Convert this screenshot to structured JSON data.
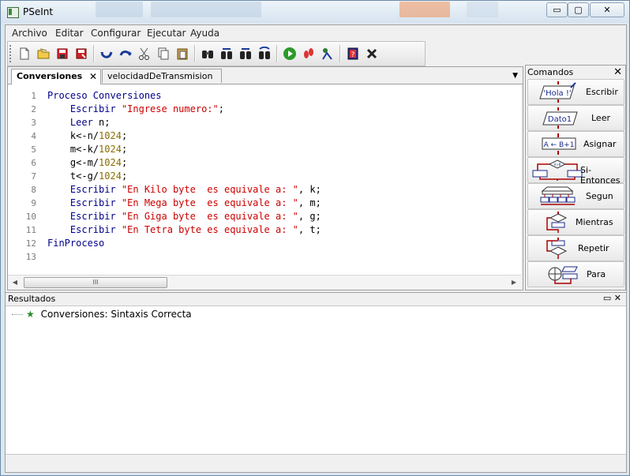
{
  "window": {
    "title": "PSeInt",
    "controls": {
      "minimize": "▭",
      "restore": "▢",
      "close": "✕"
    }
  },
  "menubar": {
    "items": [
      "Archivo",
      "Editar",
      "Configurar",
      "Ejecutar",
      "Ayuda"
    ]
  },
  "toolbar": {
    "buttons": [
      "new-file",
      "open-file",
      "save-file",
      "save-as",
      "undo",
      "redo",
      "cut",
      "copy",
      "paste",
      "find",
      "find-next",
      "find-prev",
      "replace",
      "run",
      "run-step",
      "explain",
      "help",
      "close"
    ]
  },
  "editor": {
    "tabs": [
      {
        "label": "Conversiones",
        "active": true,
        "close": "✕"
      },
      {
        "label": "velocidadDeTransmision",
        "active": false
      }
    ],
    "line_numbers": [
      "1",
      "2",
      "3",
      "4",
      "5",
      "6",
      "7",
      "8",
      "9",
      "10",
      "11",
      "12",
      "13"
    ],
    "lines": [
      [
        {
          "t": "Proceso ",
          "c": "kw"
        },
        {
          "t": "Conversiones",
          "c": "kw"
        }
      ],
      [
        {
          "t": "    Escribir ",
          "c": "kw"
        },
        {
          "t": "\"Ingrese numero:\"",
          "c": "st"
        },
        {
          "t": ";",
          "c": ""
        }
      ],
      [
        {
          "t": "    Leer ",
          "c": "kw"
        },
        {
          "t": "n;",
          "c": ""
        }
      ],
      [
        {
          "t": "    k<-n/",
          "c": ""
        },
        {
          "t": "1024",
          "c": "nm"
        },
        {
          "t": ";",
          "c": ""
        }
      ],
      [
        {
          "t": "    m<-k/",
          "c": ""
        },
        {
          "t": "1024",
          "c": "nm"
        },
        {
          "t": ";",
          "c": ""
        }
      ],
      [
        {
          "t": "    g<-m/",
          "c": ""
        },
        {
          "t": "1024",
          "c": "nm"
        },
        {
          "t": ";",
          "c": ""
        }
      ],
      [
        {
          "t": "    t<-g/",
          "c": ""
        },
        {
          "t": "1024",
          "c": "nm"
        },
        {
          "t": ";",
          "c": ""
        }
      ],
      [
        {
          "t": "    Escribir ",
          "c": "kw"
        },
        {
          "t": "\"En Kilo byte  es equivale a: \"",
          "c": "st"
        },
        {
          "t": ", k;",
          "c": ""
        }
      ],
      [
        {
          "t": "    Escribir ",
          "c": "kw"
        },
        {
          "t": "\"En Mega byte  es equivale a: \"",
          "c": "st"
        },
        {
          "t": ", m;",
          "c": ""
        }
      ],
      [
        {
          "t": "    Escribir ",
          "c": "kw"
        },
        {
          "t": "\"En Giga byte  es equivale a: \"",
          "c": "st"
        },
        {
          "t": ", g;",
          "c": ""
        }
      ],
      [
        {
          "t": "    Escribir ",
          "c": "kw"
        },
        {
          "t": "\"En Tetra byte es equivale a: \"",
          "c": "st"
        },
        {
          "t": ", t;",
          "c": ""
        }
      ],
      [
        {
          "t": "FinProceso",
          "c": "kw"
        }
      ],
      []
    ],
    "hscroll": {
      "left": "◀",
      "thumb": "III",
      "right": "▶"
    }
  },
  "commands": {
    "title": "Comandos",
    "close": "✕",
    "items": [
      {
        "label": "Escribir",
        "glyph": "'Hola !'"
      },
      {
        "label": "Leer",
        "glyph": "Dato1"
      },
      {
        "label": "Asignar",
        "glyph": "A ← B+1"
      },
      {
        "label": "Si-Entonces",
        "glyph": "A>B"
      },
      {
        "label": "Segun",
        "glyph": ""
      },
      {
        "label": "Mientras",
        "glyph": ""
      },
      {
        "label": "Repetir",
        "glyph": ""
      },
      {
        "label": "Para",
        "glyph": ""
      }
    ]
  },
  "results": {
    "title": "Resultados",
    "buttons": "▭ ✕",
    "items": [
      {
        "text": "Conversiones: Sintaxis Correcta"
      }
    ]
  },
  "colors": {
    "keyword": "#00008b",
    "string": "#cc0000",
    "number": "#8b6d00"
  }
}
